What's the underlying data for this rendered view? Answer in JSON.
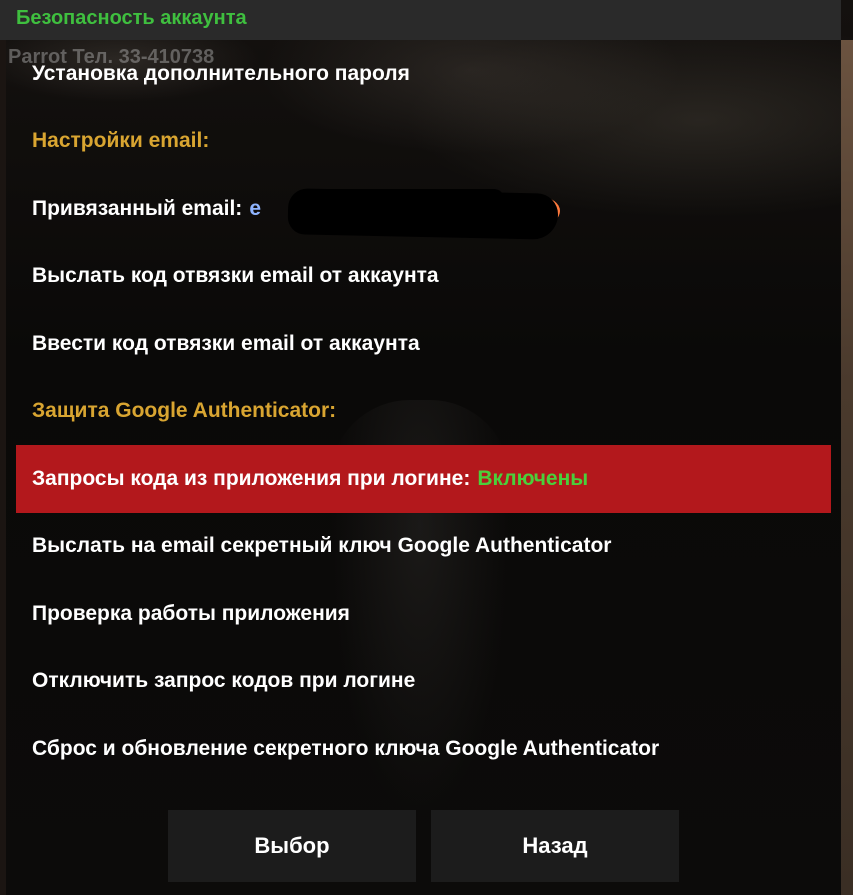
{
  "window": {
    "title": "Безопасность аккаунта",
    "background_overlay_text": "Parrot Тел. 33-410738"
  },
  "menu": {
    "items": [
      {
        "label": "Установка дополнительного пароля"
      },
      {
        "label": "Настройки email:"
      },
      {
        "label": "Привязанный email:",
        "value_prefix": "e"
      },
      {
        "label": "Выслать код отвязки email от аккаунта"
      },
      {
        "label": "Ввести код отвязки email от аккаунта"
      },
      {
        "label": "Защита Google Authenticator:"
      },
      {
        "label": "Запросы кода из приложения при логине:",
        "status": "Включены"
      },
      {
        "label": "Выслать на email секретный ключ Google Authenticator"
      },
      {
        "label": "Проверка работы приложения"
      },
      {
        "label": "Отключить запрос кодов при логине"
      },
      {
        "label": "Сброс и обновление секретного ключа Google Authenticator"
      }
    ]
  },
  "buttons": {
    "select_label": "Выбор",
    "back_label": "Назад"
  },
  "colors": {
    "title": "#3fbf3f",
    "section_header": "#d9a531",
    "selected_row": "#b3181c",
    "status_enabled": "#4bcf3b",
    "button_bg": "#1c1c1c",
    "titlebar_bg": "#2a2a2a"
  }
}
